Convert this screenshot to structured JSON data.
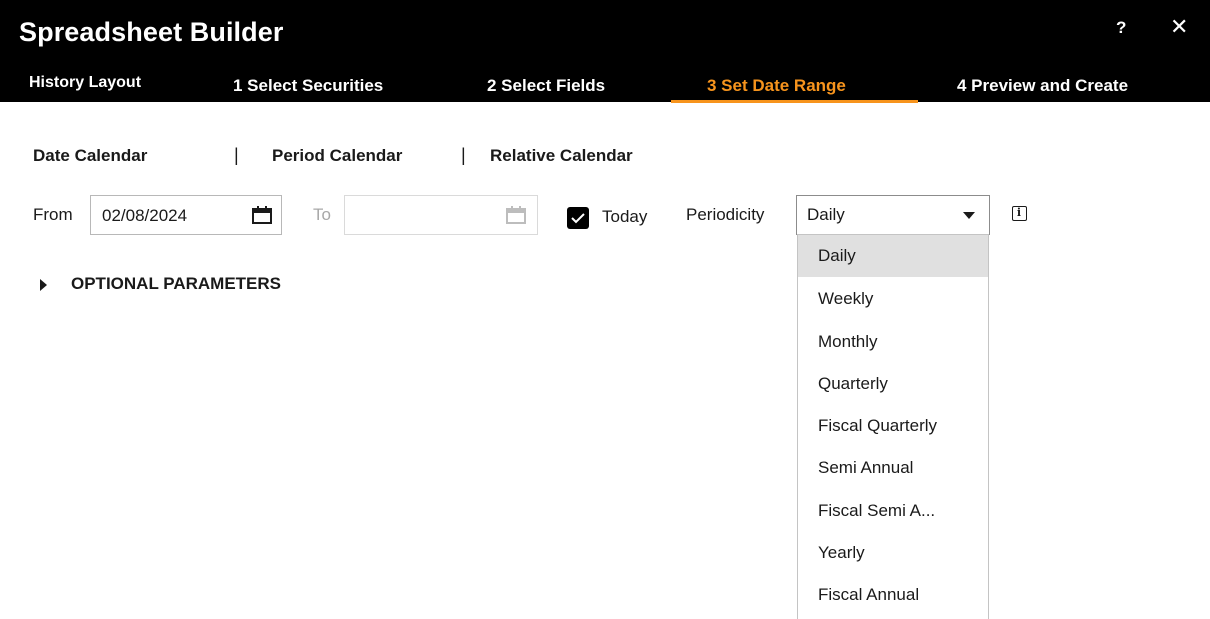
{
  "window": {
    "title": "Spreadsheet Builder",
    "help_label": "?",
    "close_label": "✕"
  },
  "tabs": [
    {
      "label": "History Layout"
    },
    {
      "label": "1 Select Securities"
    },
    {
      "label": "2 Select Fields"
    },
    {
      "label": "3 Set Date Range",
      "active": true
    },
    {
      "label": "4 Preview and Create"
    }
  ],
  "calendar_modes": [
    {
      "label": "Date Calendar"
    },
    {
      "label": "Period Calendar"
    },
    {
      "label": "Relative Calendar"
    }
  ],
  "separator": "|",
  "date_range": {
    "from_label": "From",
    "from_value": "02/08/2024",
    "to_label": "To",
    "to_value": "",
    "today_label": "Today",
    "today_checked": true
  },
  "periodicity": {
    "label": "Periodicity",
    "selected": "Daily",
    "options": [
      "Daily",
      "Weekly",
      "Monthly",
      "Quarterly",
      "Fiscal Quarterly",
      "Semi Annual",
      "Fiscal Semi A...",
      "Yearly",
      "Fiscal Annual"
    ]
  },
  "optional_parameters": {
    "label": "OPTIONAL PARAMETERS"
  },
  "colors": {
    "titlebar_bg": "#000000",
    "accent": "#f7941d",
    "selected_option_bg": "#e0e0e0"
  }
}
